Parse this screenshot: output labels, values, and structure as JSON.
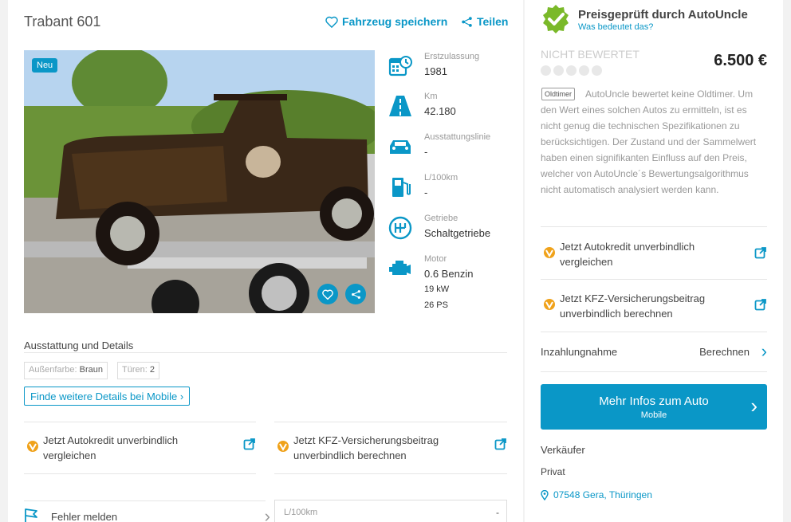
{
  "listing": {
    "title": "Trabant 601",
    "save_label": "Fahrzeug speichern",
    "share_label": "Teilen",
    "badge": "Neu"
  },
  "specs": [
    {
      "label": "Erstzulassung",
      "value": "1981",
      "icon": "calendar-icon"
    },
    {
      "label": "Km",
      "value": "42.180",
      "icon": "road-icon"
    },
    {
      "label": "Ausstattungslinie",
      "value": "-",
      "icon": "car-icon"
    },
    {
      "label": "L/100km",
      "value": "-",
      "icon": "fuel-pump-icon"
    },
    {
      "label": "Getriebe",
      "value": "Schaltgetriebe",
      "icon": "gearbox-icon"
    },
    {
      "label": "Motor",
      "value": "0.6 Benzin",
      "extra1": "19 kW",
      "extra2": "26 PS",
      "icon": "engine-icon"
    }
  ],
  "details": {
    "title": "Ausstattung und Details",
    "tags": [
      {
        "label": "Außenfarbe:",
        "value": "Braun"
      },
      {
        "label": "Türen:",
        "value": "2"
      }
    ],
    "more_button": "Finde weitere Details bei Mobile"
  },
  "promos": {
    "credit": {
      "line1": "Jetzt Autokredit unverbindlich",
      "line2": "vergleichen"
    },
    "insurance": {
      "line1": "Jetzt KFZ-Versicherungsbeitrag",
      "line2": "unverbindlich berechnen"
    }
  },
  "footer": {
    "report_label": "Fehler melden",
    "lkm_label": "L/100km",
    "lkm_value": "-"
  },
  "sidebar": {
    "verified_title": "Preisgeprüft durch AutoUncle",
    "verified_link": "Was bedeutet das?",
    "rating_label": "NICHT BEWERTET",
    "price": "6.500 €",
    "oldtimer_tag": "Oldtimer",
    "description": "AutoUncle bewertet keine Oldtimer. Um den Wert eines solchen Autos zu ermitteln, ist es nicht genug die technischen Spezifikationen zu berücksichtigen. Der Zustand und der Sammelwert haben einen signifikanten Einfluss auf den Preis, welcher von AutoUncle´s Bewertungsalgorithmus nicht automatisch analysiert werden kann.",
    "trade_in_label": "Inzahlungnahme",
    "trade_in_action": "Berechnen",
    "cta_title": "Mehr Infos zum Auto",
    "cta_sub": "Mobile",
    "seller_heading": "Verkäufer",
    "seller_type": "Privat",
    "seller_location": "07548 Gera, Thüringen"
  },
  "colors": {
    "accent": "#0a97c7",
    "verified": "#7ab929",
    "promo_logo": "#f0a21a"
  }
}
